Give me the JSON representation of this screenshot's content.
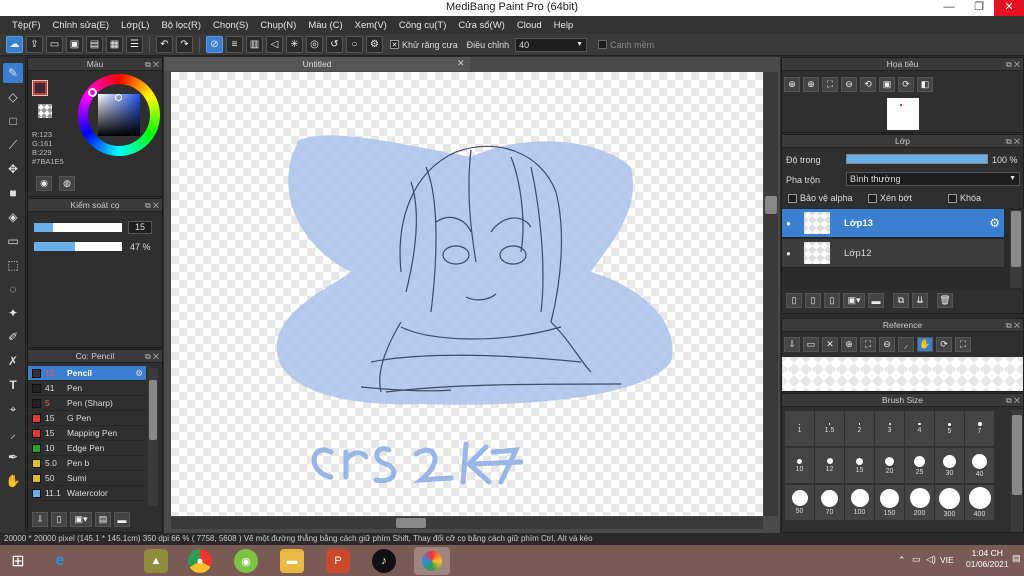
{
  "window": {
    "title": "MediBang Paint Pro (64bit)",
    "min": "—",
    "max": "❐",
    "close": "✕"
  },
  "menu": [
    "Tệp(F)",
    "Chỉnh sửa(E)",
    "Lớp(L)",
    "Bộ lọc(R)",
    "Chọn(S)",
    "Chụp(N)",
    "Màu (C)",
    "Xem(V)",
    "Công cụ(T)",
    "Cửa sổ(W)",
    "Cloud",
    "Help"
  ],
  "toolbar": {
    "antialias_label": "Khử răng cưa",
    "adjust_label": "Điều chỉnh",
    "adjust_value": "40",
    "edge_label": "Canh mềm"
  },
  "color_panel": {
    "title": "Màu",
    "r": "R:123",
    "g": "G:161",
    "b": "B:229",
    "hex": "#7BA1E5",
    "primary": "#7BA1E5"
  },
  "brush_control": {
    "title": "Kiểm soát cọ",
    "size_value": "15",
    "opacity_value": "47 %",
    "size_fill": 0.22,
    "opacity_fill": 0.47
  },
  "brush_list": {
    "title": "Cọ: Pencil",
    "items": [
      {
        "size": "15",
        "name": "Pencil",
        "color": "#333333",
        "selected": true
      },
      {
        "size": "41",
        "name": "Pen",
        "color": "#222222"
      },
      {
        "size": "5",
        "name": "Pen (Sharp)",
        "color": "#222222"
      },
      {
        "size": "15",
        "name": "G Pen",
        "color": "#e53935"
      },
      {
        "size": "15",
        "name": "Mapping Pen",
        "color": "#e53935"
      },
      {
        "size": "10",
        "name": "Edge Pen",
        "color": "#2e9e2e"
      },
      {
        "size": "5.0",
        "name": "Pen b",
        "color": "#e0c020"
      },
      {
        "size": "50",
        "name": "Sumi",
        "color": "#e0c020"
      },
      {
        "size": "11.1",
        "name": "Watercolor",
        "color": "#6ab0e8"
      }
    ]
  },
  "document": {
    "tab": "Untitled",
    "close": "✕"
  },
  "navigator": {
    "title": "Họa tiêu"
  },
  "layers": {
    "title": "Lớp",
    "opacity_label": "Độ trong",
    "opacity_value": "100 %",
    "blend_label": "Pha trộn",
    "blend_value": "Bình thường",
    "protect_alpha": "Bảo vệ alpha",
    "clipping": "Xén bớt",
    "lock": "Khóa",
    "items": [
      {
        "name": "Lớp13",
        "selected": true
      },
      {
        "name": "Lớp12",
        "selected": false
      }
    ]
  },
  "reference": {
    "title": "Reference"
  },
  "brush_size": {
    "title": "Brush Size",
    "sizes": [
      "1",
      "1.5",
      "2",
      "3",
      "4",
      "5",
      "7",
      "10",
      "12",
      "15",
      "20",
      "25",
      "30",
      "40",
      "50",
      "70",
      "100",
      "150",
      "200",
      "300",
      "400"
    ]
  },
  "status": {
    "text": "20000 * 20000 pixel  (145.1 * 145.1cm)  350 dpi  66 %  ( 7758, 5608 )  Vẽ một đường thẳng bằng cách giữ phím Shift, Thay đổi cỡ cọ bằng cách giữ phím Ctrl, Alt và kéo"
  },
  "taskbar": {
    "lang": "VIE",
    "time": "1:04 CH",
    "date": "01/06/2021"
  },
  "artwork": {
    "signature": "crs 2k7"
  }
}
